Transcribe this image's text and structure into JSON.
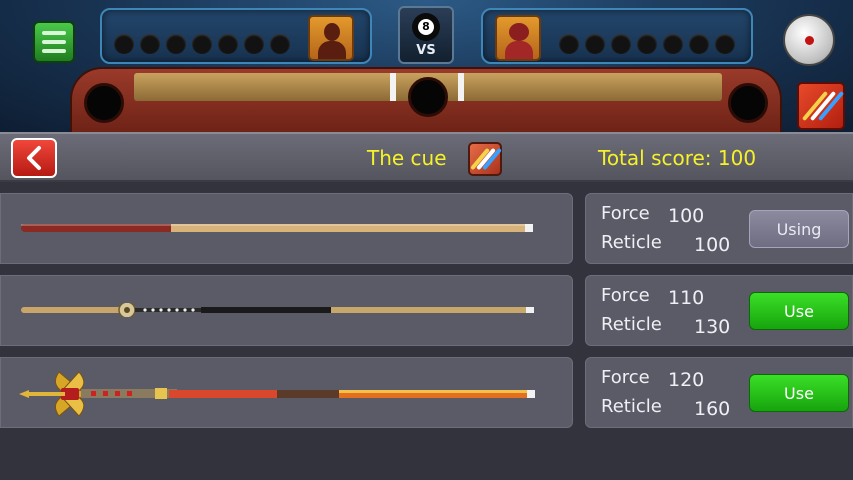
{
  "hud": {
    "menu_icon": "hamburger-menu-icon",
    "vs_ball_number": "8",
    "vs_label": "VS",
    "settings_icon": "cue-ball-icon",
    "cue_shop_icon": "cue-sticks-icon"
  },
  "header": {
    "title": "The cue",
    "title_icon": "cue-sticks-icon",
    "score_label": "Total score: 100",
    "back_icon": "chevron-left-icon"
  },
  "cues": [
    {
      "force_label": "Force",
      "force_value": "100",
      "reticle_label": "Reticle",
      "reticle_value": "100",
      "action_label": "Using",
      "state": "using"
    },
    {
      "force_label": "Force",
      "force_value": "110",
      "reticle_label": "Reticle",
      "reticle_value": "130",
      "action_label": "Use",
      "state": "available"
    },
    {
      "force_label": "Force",
      "force_value": "120",
      "reticle_label": "Reticle",
      "reticle_value": "160",
      "action_label": "Use",
      "state": "available"
    }
  ],
  "colors": {
    "accent_yellow": "#f6f227",
    "use_green": "#21c216",
    "back_red": "#d8281e",
    "row_gray": "#5b5b68"
  }
}
